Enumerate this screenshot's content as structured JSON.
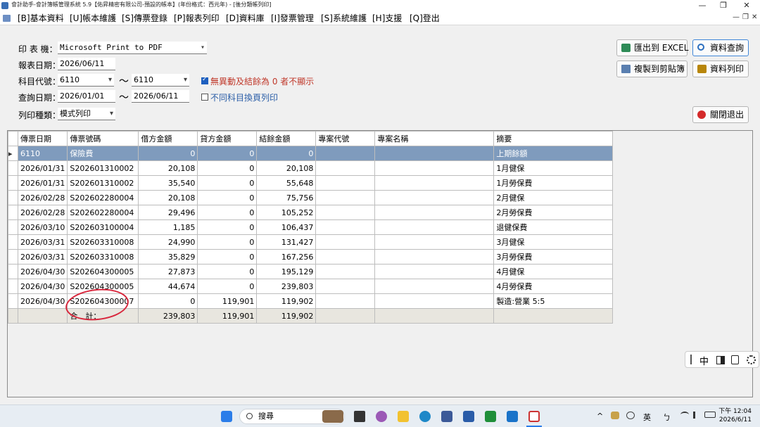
{
  "window": {
    "title": "會計助手-會計簿帳管理系統 5.9【佑昇精密有限公司-預設的帳本】(年份格式：西元年) - [後分類帳列印]",
    "minimize": "—",
    "maximize": "❐",
    "close": "✕"
  },
  "menu": {
    "items": [
      "[B]基本資料",
      "[U]帳本維護",
      "[S]傳票登錄",
      "[P]報表列印",
      "[D]資料庫",
      "[I]發票管理",
      "[S]系統維護",
      "[H]支援",
      "[Q]登出"
    ],
    "mdi_min": "—",
    "mdi_restore": "❐",
    "mdi_close": "✕"
  },
  "form": {
    "printer_label": "印 表 機：",
    "printer_value": "Microsoft Print to PDF",
    "report_date_label": "報表日期：",
    "report_date_value": "2026/06/11",
    "account_label": "科目代號：",
    "account_from": "6110",
    "account_to": "6110",
    "tilde": "～",
    "query_date_label": "查詢日期：",
    "date_from": "2026/01/01",
    "date_to": "2026/06/11",
    "print_type_label": "列印種類：",
    "print_type_value": "模式列印",
    "option1_label": "無異動及結餘為 0 者不顯示",
    "option1_checked": true,
    "option2_label": "不同科目換頁列印",
    "option2_checked": false
  },
  "buttons": {
    "export_excel": "匯出到 EXCEL",
    "query": "資料查詢",
    "copy_clipboard": "複製到剪貼簿",
    "print": "資料列印",
    "close": "關閉退出"
  },
  "grid": {
    "columns": [
      "傳票日期",
      "傳票號碼",
      "借方金額",
      "貸方金額",
      "結餘金額",
      "專案代號",
      "專案名稱",
      "摘要"
    ],
    "rows": [
      [
        "6110",
        "保險費",
        "0",
        "0",
        "0",
        "",
        "",
        "上期餘額"
      ],
      [
        "2026/01/31",
        "S202601310002",
        "20,108",
        "0",
        "20,108",
        "",
        "",
        "1月健保"
      ],
      [
        "2026/01/31",
        "S202601310002",
        "35,540",
        "0",
        "55,648",
        "",
        "",
        "1月勞保費"
      ],
      [
        "2026/02/28",
        "S202602280004",
        "20,108",
        "0",
        "75,756",
        "",
        "",
        "2月健保"
      ],
      [
        "2026/02/28",
        "S202602280004",
        "29,496",
        "0",
        "105,252",
        "",
        "",
        "2月勞保費"
      ],
      [
        "2026/03/10",
        "S202603100004",
        "1,185",
        "0",
        "106,437",
        "",
        "",
        "退健保費"
      ],
      [
        "2026/03/31",
        "S202603310008",
        "24,990",
        "0",
        "131,427",
        "",
        "",
        "3月健保"
      ],
      [
        "2026/03/31",
        "S202603310008",
        "35,829",
        "0",
        "167,256",
        "",
        "",
        "3月勞保費"
      ],
      [
        "2026/04/30",
        "S202604300005",
        "27,873",
        "0",
        "195,129",
        "",
        "",
        "4月健保"
      ],
      [
        "2026/04/30",
        "S202604300005",
        "44,674",
        "0",
        "239,803",
        "",
        "",
        "4月勞保費"
      ],
      [
        "2026/04/30",
        "S202604300007",
        "0",
        "119,901",
        "119,902",
        "",
        "",
        "製造:營業 5:5"
      ]
    ],
    "total": [
      "",
      "合　計：",
      "239,803",
      "119,901",
      "119,902",
      "",
      "",
      ""
    ],
    "row_indicator": "▸"
  },
  "ime": {
    "mode": "中"
  },
  "taskbar": {
    "search_placeholder": "搜尋",
    "lang": "英",
    "ime_glyph": "ㄅ",
    "time_label": "下午 12:04",
    "date": "2026/6/11"
  },
  "colors": {
    "selected_row": "#7f9bbd",
    "checkbox_label": "#c0392b",
    "option2_label": "#2b5ea7",
    "annotation": "#d8263c"
  }
}
